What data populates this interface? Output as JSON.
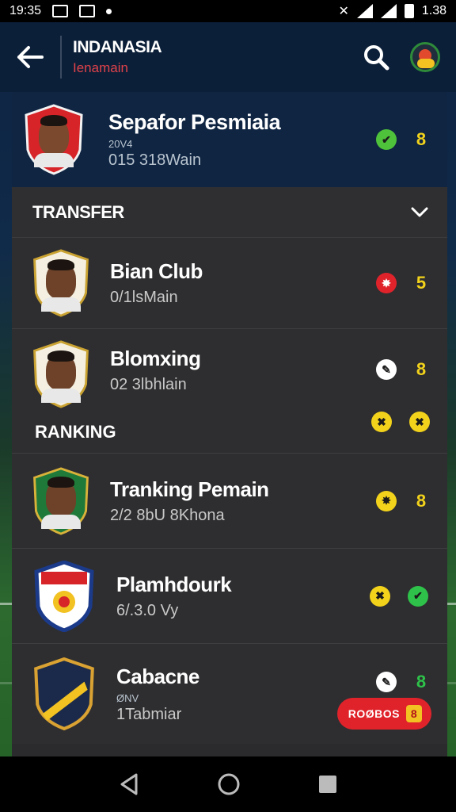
{
  "status_bar": {
    "time": "19:35",
    "battery_text": "1.38"
  },
  "header": {
    "title": "INDANASIA",
    "subtitle": "Ienamain"
  },
  "profile": {
    "name": "Sepafor Pesmiaia",
    "note": "20V4",
    "meta": "015 318Wain",
    "badge_color": "#4ec23a",
    "score": "8"
  },
  "transfer_section": {
    "title": "TRANSFER"
  },
  "ranking_section": {
    "title": "RANKING"
  },
  "items": [
    {
      "name": "Bian Club",
      "note": "",
      "meta": "0/1lsMain",
      "badge_color": "#e0232b",
      "score": "5",
      "crest_color": "#f4efe0"
    },
    {
      "name": "Blomxing",
      "note": "",
      "meta": "02 3lbhlain",
      "badge_color": "#ffffff",
      "score": "8",
      "crest_color": "#f4efe0",
      "extra_badges": [
        "#f2d21b",
        "#f2d21b"
      ]
    },
    {
      "name": "Tranking Pemain",
      "note": "",
      "meta": "2/2 8bU 8Khona",
      "badge_color": "#f2d21b",
      "score": "8",
      "crest_color": "#1f7a3a"
    },
    {
      "name": "Plamhdourk",
      "note": "",
      "meta": "6/.3.0 Vy",
      "badge_color": "#f2d21b",
      "score": "",
      "second_badge_color": "#2ec24a",
      "crest_color": "#ffffff"
    },
    {
      "name": "Cabacne",
      "note": "ØNV",
      "meta": "1Tabmiar",
      "badge_color": "#ffffff",
      "score": "8",
      "score_green": true,
      "crest_color": "#1b2a4a"
    }
  ],
  "buy_button": {
    "label": "ROØBOS"
  }
}
